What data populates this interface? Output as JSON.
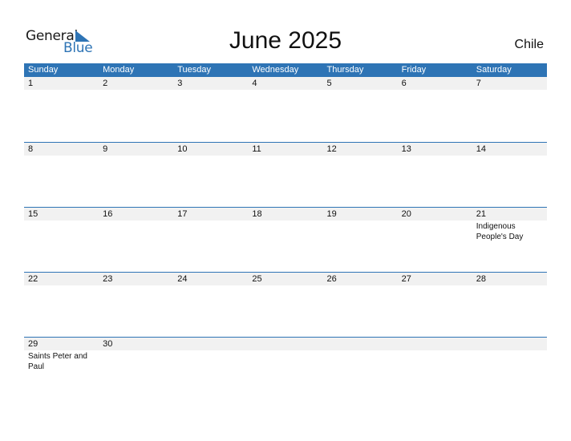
{
  "logo": {
    "word1": "General",
    "word2": "Blue",
    "accent": "#2e74b5"
  },
  "title": "June 2025",
  "country": "Chile",
  "colors": {
    "header_bg": "#2e74b5",
    "day_bg": "#f1f1f1"
  },
  "weekdays": [
    "Sunday",
    "Monday",
    "Tuesday",
    "Wednesday",
    "Thursday",
    "Friday",
    "Saturday"
  ],
  "weeks": [
    [
      {
        "d": "1",
        "h": ""
      },
      {
        "d": "2",
        "h": ""
      },
      {
        "d": "3",
        "h": ""
      },
      {
        "d": "4",
        "h": ""
      },
      {
        "d": "5",
        "h": ""
      },
      {
        "d": "6",
        "h": ""
      },
      {
        "d": "7",
        "h": ""
      }
    ],
    [
      {
        "d": "8",
        "h": ""
      },
      {
        "d": "9",
        "h": ""
      },
      {
        "d": "10",
        "h": ""
      },
      {
        "d": "11",
        "h": ""
      },
      {
        "d": "12",
        "h": ""
      },
      {
        "d": "13",
        "h": ""
      },
      {
        "d": "14",
        "h": ""
      }
    ],
    [
      {
        "d": "15",
        "h": ""
      },
      {
        "d": "16",
        "h": ""
      },
      {
        "d": "17",
        "h": ""
      },
      {
        "d": "18",
        "h": ""
      },
      {
        "d": "19",
        "h": ""
      },
      {
        "d": "20",
        "h": ""
      },
      {
        "d": "21",
        "h": "Indigenous People's Day"
      }
    ],
    [
      {
        "d": "22",
        "h": ""
      },
      {
        "d": "23",
        "h": ""
      },
      {
        "d": "24",
        "h": ""
      },
      {
        "d": "25",
        "h": ""
      },
      {
        "d": "26",
        "h": ""
      },
      {
        "d": "27",
        "h": ""
      },
      {
        "d": "28",
        "h": ""
      }
    ],
    [
      {
        "d": "29",
        "h": "Saints Peter and Paul"
      },
      {
        "d": "30",
        "h": ""
      },
      {
        "d": "",
        "h": ""
      },
      {
        "d": "",
        "h": ""
      },
      {
        "d": "",
        "h": ""
      },
      {
        "d": "",
        "h": ""
      },
      {
        "d": "",
        "h": ""
      }
    ]
  ]
}
